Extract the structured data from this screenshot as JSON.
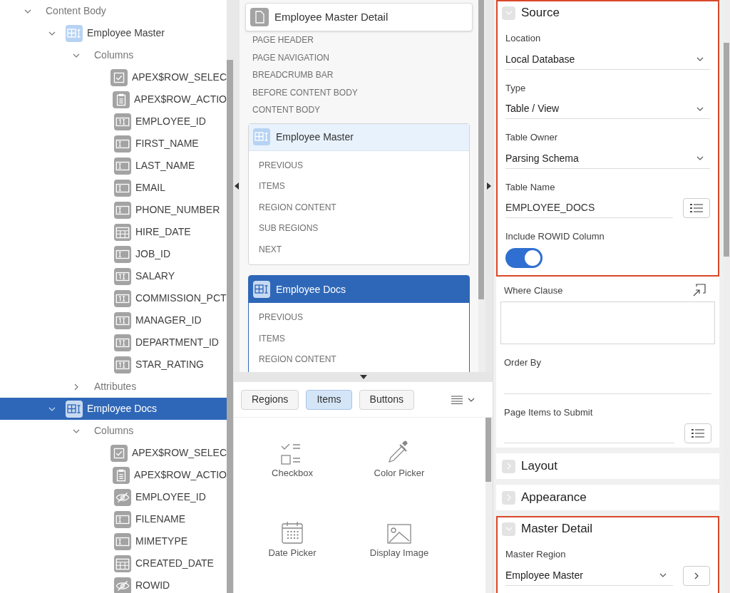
{
  "tree": [
    {
      "label": "Content Body",
      "kind": "group",
      "expanded": true,
      "selected": false,
      "children": [
        {
          "label": "Employee Master",
          "kind": "region",
          "expanded": true,
          "selected": false,
          "children": [
            {
              "label": "Columns",
              "kind": "group",
              "expanded": true,
              "selected": false,
              "children": [
                {
                  "label": "APEX$ROW_SELEC",
                  "kind": "checkbox",
                  "selected": false
                },
                {
                  "label": "APEX$ROW_ACTIO",
                  "kind": "actions",
                  "selected": false
                },
                {
                  "label": "EMPLOYEE_ID",
                  "kind": "number",
                  "selected": false
                },
                {
                  "label": "FIRST_NAME",
                  "kind": "text",
                  "selected": false
                },
                {
                  "label": "LAST_NAME",
                  "kind": "text",
                  "selected": false
                },
                {
                  "label": "EMAIL",
                  "kind": "text",
                  "selected": false
                },
                {
                  "label": "PHONE_NUMBER",
                  "kind": "text",
                  "selected": false
                },
                {
                  "label": "HIRE_DATE",
                  "kind": "date",
                  "selected": false
                },
                {
                  "label": "JOB_ID",
                  "kind": "text",
                  "selected": false
                },
                {
                  "label": "SALARY",
                  "kind": "number",
                  "selected": false
                },
                {
                  "label": "COMMISSION_PCT",
                  "kind": "number",
                  "selected": false
                },
                {
                  "label": "MANAGER_ID",
                  "kind": "number",
                  "selected": false
                },
                {
                  "label": "DEPARTMENT_ID",
                  "kind": "number",
                  "selected": false
                },
                {
                  "label": "STAR_RATING",
                  "kind": "number",
                  "selected": false
                }
              ]
            },
            {
              "label": "Attributes",
              "kind": "group",
              "expanded": false,
              "selected": false
            }
          ]
        },
        {
          "label": "Employee Docs",
          "kind": "region",
          "expanded": true,
          "selected": true,
          "children": [
            {
              "label": "Columns",
              "kind": "group",
              "expanded": true,
              "selected": false,
              "children": [
                {
                  "label": "APEX$ROW_SELEC",
                  "kind": "checkbox",
                  "selected": false
                },
                {
                  "label": "APEX$ROW_ACTIO",
                  "kind": "actions",
                  "selected": false
                },
                {
                  "label": "EMPLOYEE_ID",
                  "kind": "hidden",
                  "selected": false
                },
                {
                  "label": "FILENAME",
                  "kind": "text",
                  "selected": false
                },
                {
                  "label": "MIMETYPE",
                  "kind": "text",
                  "selected": false
                },
                {
                  "label": "CREATED_DATE",
                  "kind": "date",
                  "selected": false
                },
                {
                  "label": "ROWID",
                  "kind": "hidden",
                  "selected": false
                }
              ]
            }
          ]
        }
      ]
    }
  ],
  "layout": {
    "page_title": "Employee Master Detail",
    "positions": [
      "PAGE HEADER",
      "PAGE NAVIGATION",
      "BREADCRUMB BAR",
      "BEFORE CONTENT BODY",
      "CONTENT BODY"
    ],
    "regions": [
      {
        "title": "Employee Master",
        "selected": false,
        "slots": [
          "PREVIOUS",
          "ITEMS",
          "REGION CONTENT",
          "SUB REGIONS",
          "NEXT"
        ]
      },
      {
        "title": "Employee Docs",
        "selected": true,
        "slots": [
          "PREVIOUS",
          "ITEMS",
          "REGION CONTENT"
        ]
      }
    ]
  },
  "gallery": {
    "tabs": [
      {
        "label": "Regions",
        "selected": false
      },
      {
        "label": "Items",
        "selected": true
      },
      {
        "label": "Buttons",
        "selected": false
      }
    ],
    "items": [
      {
        "label": "Checkbox",
        "kind": "checkbox"
      },
      {
        "label": "Color Picker",
        "kind": "color"
      },
      {
        "label": "Date Picker",
        "kind": "date"
      },
      {
        "label": "Display Image",
        "kind": "image"
      }
    ]
  },
  "properties": [
    {
      "title": "Source",
      "expanded": true,
      "highlighted": true,
      "fields": [
        {
          "label": "Location",
          "kind": "select",
          "value": "Local Database"
        },
        {
          "label": "Type",
          "kind": "select",
          "value": "Table / View"
        },
        {
          "label": "Table Owner",
          "kind": "select",
          "value": "Parsing Schema"
        },
        {
          "label": "Table Name",
          "kind": "text",
          "value": "EMPLOYEE_DOCS",
          "list_button": true
        },
        {
          "label": "Include ROWID Column",
          "kind": "switch",
          "on": true
        }
      ],
      "more_fields": [
        {
          "label": "Where Clause",
          "kind": "textarea"
        },
        {
          "label": "Order By",
          "kind": "text",
          "list_button": false
        },
        {
          "label": "Page Items to Submit",
          "kind": "text",
          "list_button": true
        }
      ]
    },
    {
      "title": "Layout",
      "expanded": false,
      "highlighted": false
    },
    {
      "title": "Appearance",
      "expanded": false,
      "highlighted": false
    },
    {
      "title": "Master Detail",
      "expanded": true,
      "highlighted": true,
      "fields": [
        {
          "label": "Master Region",
          "kind": "select",
          "value": "Employee Master",
          "go_button": true
        }
      ]
    }
  ]
}
